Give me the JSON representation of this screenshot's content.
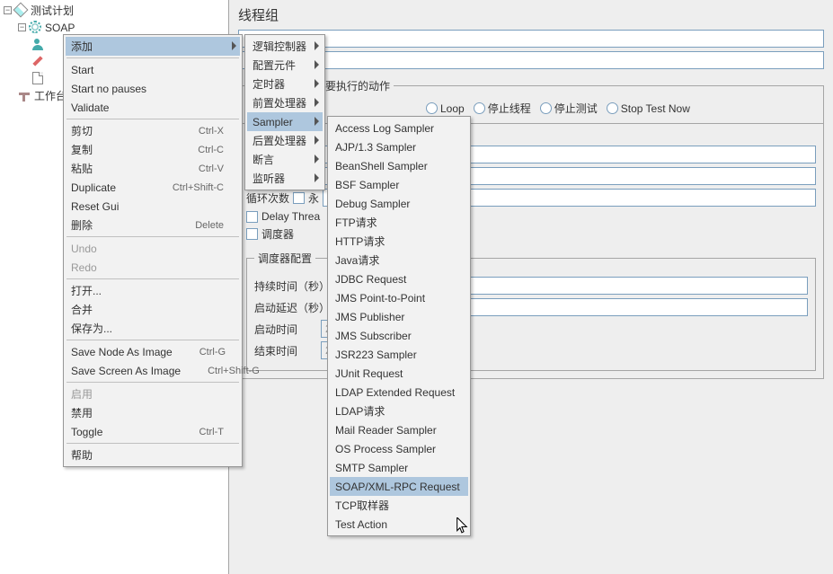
{
  "tree": {
    "root": "测试计划",
    "nodes": [
      "SOAP",
      "工作台"
    ]
  },
  "main": {
    "title": "线程组",
    "fieldset1_legend": "在取样器错误后要执行的动作",
    "radios": {
      "r3": "Loop",
      "r4": "停止线程",
      "r5": "停止测试",
      "r6": "Stop Test Now"
    },
    "loop_label": "循环次数",
    "forever": "永",
    "delay_label": "Delay Threa",
    "scheduler_label": "调度器",
    "sched_legend": "调度器配置",
    "duration_label": "持续时间（秒）",
    "startup_delay_label": "启动延迟（秒）",
    "start_time_label": "启动时间",
    "end_time_label": "结束时间",
    "start_time_val": "2017",
    "end_time_val": "2017"
  },
  "menu1": [
    {
      "label": "添加",
      "arrow": true,
      "hl": true
    },
    {
      "sep": true
    },
    {
      "label": "Start"
    },
    {
      "label": "Start no pauses"
    },
    {
      "label": "Validate"
    },
    {
      "sep": true
    },
    {
      "label": "剪切",
      "accel": "Ctrl-X"
    },
    {
      "label": "复制",
      "accel": "Ctrl-C"
    },
    {
      "label": "粘贴",
      "accel": "Ctrl-V"
    },
    {
      "label": "Duplicate",
      "accel": "Ctrl+Shift-C"
    },
    {
      "label": "Reset Gui"
    },
    {
      "label": "删除",
      "accel": "Delete"
    },
    {
      "sep": true
    },
    {
      "label": "Undo",
      "disabled": true
    },
    {
      "label": "Redo",
      "disabled": true
    },
    {
      "sep": true
    },
    {
      "label": "打开..."
    },
    {
      "label": "合并"
    },
    {
      "label": "保存为..."
    },
    {
      "sep": true
    },
    {
      "label": "Save Node As Image",
      "accel": "Ctrl-G"
    },
    {
      "label": "Save Screen As Image",
      "accel": "Ctrl+Shift-G"
    },
    {
      "sep": true
    },
    {
      "label": "启用",
      "disabled": true
    },
    {
      "label": "禁用"
    },
    {
      "label": "Toggle",
      "accel": "Ctrl-T"
    },
    {
      "sep": true
    },
    {
      "label": "帮助"
    }
  ],
  "menu2": [
    {
      "label": "逻辑控制器",
      "arrow": true
    },
    {
      "label": "配置元件",
      "arrow": true
    },
    {
      "label": "定时器",
      "arrow": true
    },
    {
      "label": "前置处理器",
      "arrow": true
    },
    {
      "label": "Sampler",
      "arrow": true,
      "hl": true
    },
    {
      "label": "后置处理器",
      "arrow": true
    },
    {
      "label": "断言",
      "arrow": true
    },
    {
      "label": "监听器",
      "arrow": true
    }
  ],
  "menu3": [
    {
      "label": "Access Log Sampler"
    },
    {
      "label": "AJP/1.3 Sampler"
    },
    {
      "label": "BeanShell Sampler"
    },
    {
      "label": "BSF Sampler"
    },
    {
      "label": "Debug Sampler"
    },
    {
      "label": "FTP请求"
    },
    {
      "label": "HTTP请求"
    },
    {
      "label": "Java请求"
    },
    {
      "label": "JDBC Request"
    },
    {
      "label": "JMS Point-to-Point"
    },
    {
      "label": "JMS Publisher"
    },
    {
      "label": "JMS Subscriber"
    },
    {
      "label": "JSR223 Sampler"
    },
    {
      "label": "JUnit Request"
    },
    {
      "label": "LDAP Extended Request"
    },
    {
      "label": "LDAP请求"
    },
    {
      "label": "Mail Reader Sampler"
    },
    {
      "label": "OS Process Sampler"
    },
    {
      "label": "SMTP Sampler"
    },
    {
      "label": "SOAP/XML-RPC Request",
      "hl": true
    },
    {
      "label": "TCP取样器"
    },
    {
      "label": "Test Action"
    }
  ]
}
